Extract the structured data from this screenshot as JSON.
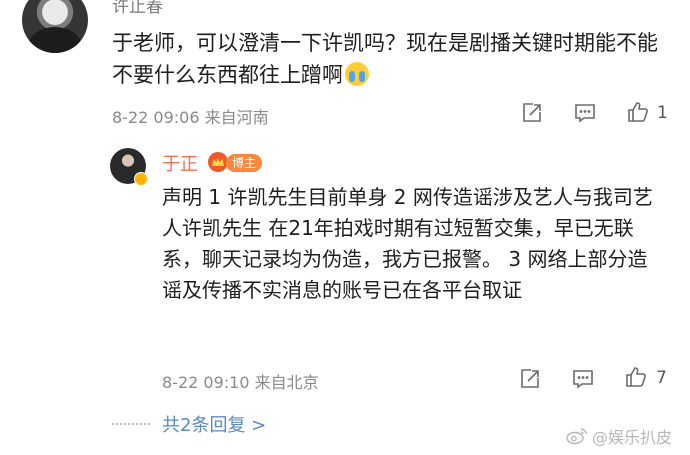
{
  "top_comment": {
    "username": "许止春",
    "text": "于老师，可以澄清一下许凯吗？现在是剧播关键时期能不能不要什么东西都往上蹭啊",
    "emoji_icon": "crying-face-icon",
    "time": "8-22 09:06",
    "location": "来自河南",
    "like_count": "1"
  },
  "reply": {
    "username": "于正",
    "badge": "博主",
    "text": "声明 1 许凯先生目前单身 2 网传造谣涉及艺人与我司艺人许凯先生 在21年拍戏时期有过短暂交集，早已无联系，聊天记录均为伪造，我方已报警。 3 网络上部分造谣及传播不实消息的账号已在各平台取证",
    "time": "8-22 09:10",
    "location": "来自北京",
    "like_count": "7"
  },
  "more_replies": "共2条回复 >",
  "watermark": "@娱乐扒皮",
  "colors": {
    "username_reply": "#eb7350",
    "link": "#5a88c1",
    "meta": "#8a8a8a",
    "badge": "#f7883d"
  }
}
